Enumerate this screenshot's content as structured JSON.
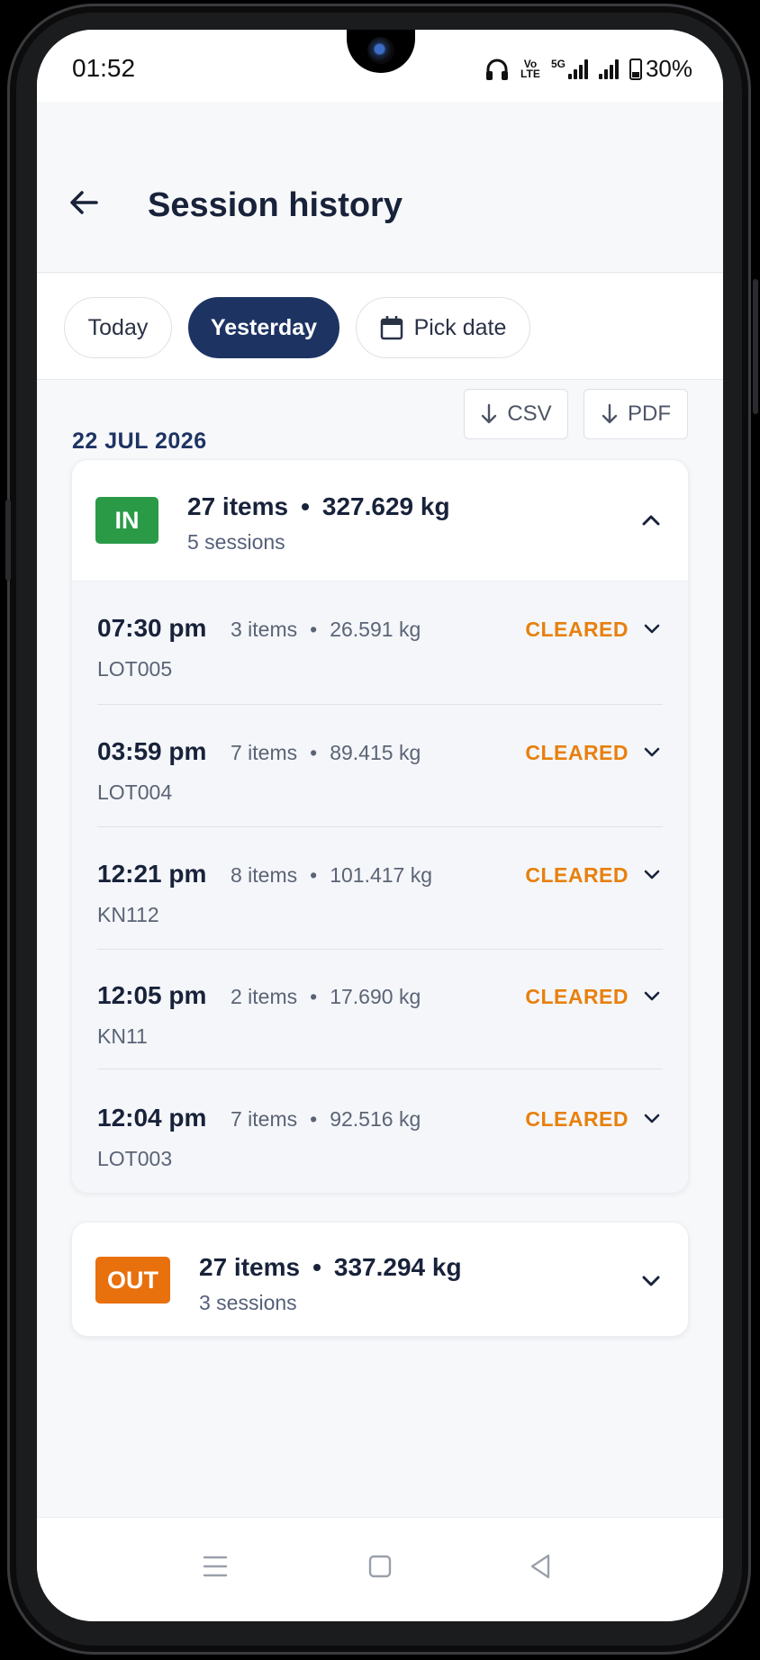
{
  "status_bar": {
    "time": "01:52",
    "volte": "Vo LTE",
    "network": "5G",
    "battery": "30%"
  },
  "header": {
    "title": "Session history"
  },
  "filters": {
    "today": "Today",
    "yesterday": "Yesterday",
    "pick_date": "Pick date",
    "selected": "Yesterday"
  },
  "date_row": {
    "date": "22 JUL 2026",
    "csv_label": "CSV",
    "pdf_label": "PDF"
  },
  "in_group": {
    "badge": "IN",
    "items": "27 items",
    "weight": "327.629 kg",
    "sessions": "5 sessions",
    "expanded": true,
    "badge_color": "#2a9a47",
    "rows": [
      {
        "time": "07:30 pm",
        "items": "3 items",
        "weight": "26.591 kg",
        "lot": "LOT005",
        "status": "CLEARED"
      },
      {
        "time": "03:59 pm",
        "items": "7 items",
        "weight": "89.415 kg",
        "lot": "LOT004",
        "status": "CLEARED"
      },
      {
        "time": "12:21 pm",
        "items": "8 items",
        "weight": "101.417 kg",
        "lot": "KN112",
        "status": "CLEARED"
      },
      {
        "time": "12:05 pm",
        "items": "2 items",
        "weight": "17.690 kg",
        "lot": "KN11",
        "status": "CLEARED"
      },
      {
        "time": "12:04 pm",
        "items": "7 items",
        "weight": "92.516 kg",
        "lot": "LOT003",
        "status": "CLEARED"
      }
    ]
  },
  "out_group": {
    "badge": "OUT",
    "items": "27 items",
    "weight": "337.294 kg",
    "sessions": "3 sessions",
    "expanded": false,
    "badge_color": "#e8700d"
  },
  "colors": {
    "primary": "#1d3463",
    "cleared": "#e8800d"
  }
}
